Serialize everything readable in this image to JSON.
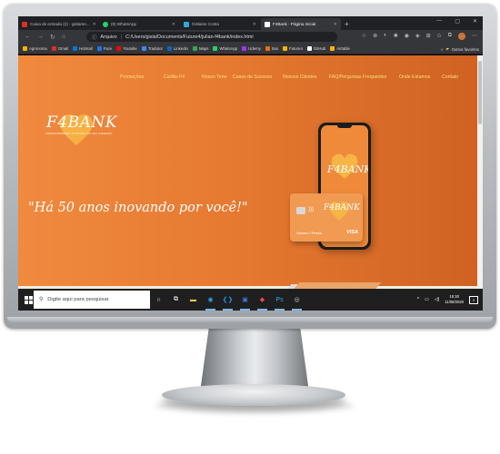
{
  "browser": {
    "tabs": [
      {
        "label": "Caixa de entrada (2) - gislame...",
        "fav_color": "#d93025",
        "active": false
      },
      {
        "label": "(9) WhatsApp",
        "fav_color": "#25d366",
        "active": false
      },
      {
        "label": "Gislaine Costa",
        "fav_color": "#2fa8d8",
        "active": false
      },
      {
        "label": "F4Bank - Página Inicial",
        "fav_color": "#ffffff",
        "active": true
      }
    ],
    "new_tab": "+",
    "window_controls": [
      "—",
      "▢",
      "✕"
    ],
    "nav": {
      "back": "←",
      "forward": "→",
      "reload": "↻",
      "home": "⌂"
    },
    "address": {
      "site_info": "Arquivo",
      "url": "C:/Users/gisla/Documents/Future4/julian-f4bank/index.html"
    },
    "bookmarks": [
      {
        "label": "Agronoma",
        "color": "#f4b400"
      },
      {
        "label": "Gmail",
        "color": "#d93025"
      },
      {
        "label": "Hotmail",
        "color": "#0078d4"
      },
      {
        "label": "Face",
        "color": "#1877f2"
      },
      {
        "label": "Youtube",
        "color": "#ff0000"
      },
      {
        "label": "Tradutor",
        "color": "#4285f4"
      },
      {
        "label": "Linkedin",
        "color": "#0a66c2"
      },
      {
        "label": "Maps",
        "color": "#34a853"
      },
      {
        "label": "WhatsApp",
        "color": "#25d366"
      },
      {
        "label": "Udemy",
        "color": "#a435f0"
      },
      {
        "label": "Itaú",
        "color": "#ec7000"
      },
      {
        "label": "Future4",
        "color": "#f4b400"
      },
      {
        "label": "GitHub",
        "color": "#ffffff"
      },
      {
        "label": "Airtable",
        "color": "#fcb400"
      }
    ],
    "bookmarks_more": "»",
    "other_favorites": "Outros favoritos"
  },
  "site": {
    "menu": [
      "Promoções",
      "Cartão F4",
      "Nosso Time",
      "Cases de Sucesso",
      "Nossos Clientes",
      "FAQ/Perguntas Frequentes",
      "Onde Estamos",
      "Contato"
    ],
    "logo": "F4BANK",
    "logo_tagline": "TRANSFORMANDO O FUTURO DO SEU DINHEIRO",
    "slogan": "\"Há 50 anos inovando por você!\"",
    "phone_logo": "F4BANK",
    "card_logo": "F4BANK",
    "card_name": "Gislaine C Pereira",
    "card_brand": "VISA"
  },
  "taskbar": {
    "search_placeholder": "Digite aqui para pesquisar",
    "apps": [
      {
        "name": "search-app",
        "glyph": "○",
        "color": "#ffffff"
      },
      {
        "name": "task-view",
        "glyph": "⧉",
        "color": "#ffffff"
      },
      {
        "name": "file-explorer",
        "glyph": "▬",
        "color": "#f4c542"
      },
      {
        "name": "edge-browser",
        "glyph": "◉",
        "color": "#2aa3e8"
      },
      {
        "name": "vscode",
        "glyph": "❮❯",
        "color": "#2a8ee6"
      },
      {
        "name": "photos",
        "glyph": "▣",
        "color": "#3c7be0"
      },
      {
        "name": "colorful-app",
        "glyph": "◆",
        "color": "#e84a5f"
      },
      {
        "name": "photoshop",
        "glyph": "Ps",
        "color": "#31a8ff"
      },
      {
        "name": "capture-app",
        "glyph": "◎",
        "color": "#cccccc"
      }
    ],
    "tray": {
      "chevron": "^",
      "time": "19:30",
      "date": "11/08/2020",
      "notifications": "2"
    }
  }
}
